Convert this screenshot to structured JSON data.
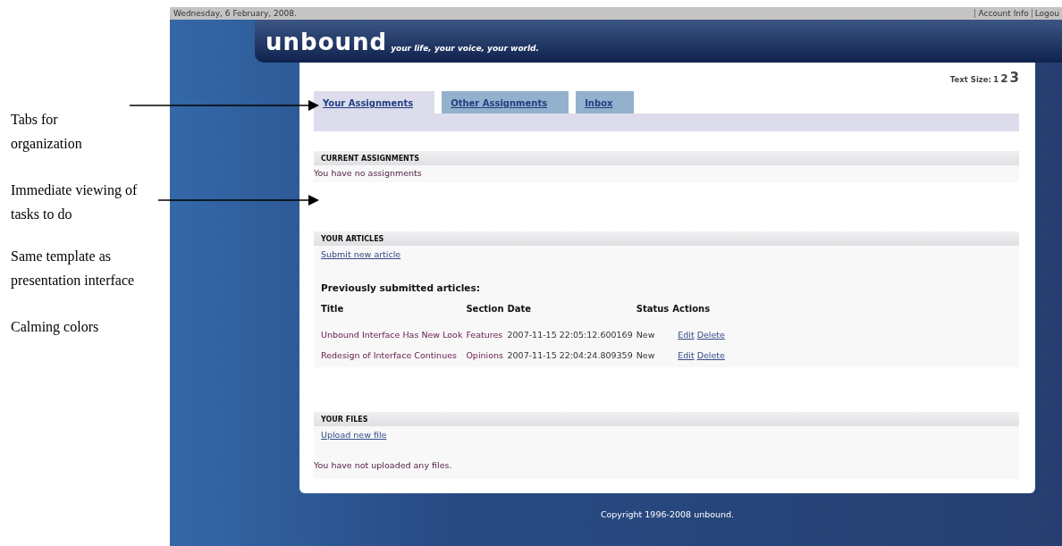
{
  "annotations": [
    {
      "text": "Tabs for organization",
      "arrow": true
    },
    {
      "text": "Immediate viewing of tasks to do",
      "arrow": true
    },
    {
      "text": "Same template as presentation interface",
      "arrow": false
    },
    {
      "text": "Calming colors",
      "arrow": false
    }
  ],
  "top_bar": {
    "date": "Wednesday, 6 February, 2008.",
    "links": [
      "Account Info",
      "Logou"
    ]
  },
  "header": {
    "logo": "unbound",
    "tagline": "your life, your voice, your world."
  },
  "text_size": {
    "label": "Text Size:",
    "options": [
      "1",
      "2",
      "3"
    ]
  },
  "tabs": [
    {
      "label": "Your Assignments",
      "selected": true
    },
    {
      "label": "Other Assignments",
      "selected": false
    },
    {
      "label": "Inbox",
      "selected": false
    }
  ],
  "sections": [
    {
      "kind": "message",
      "title": "CURRENT ASSIGNMENTS",
      "text": "You have no assignments"
    },
    {
      "kind": "articles",
      "title": "YOUR ARTICLES",
      "link": "Submit new article",
      "subtitle": "Previously submitted articles:",
      "columns": [
        "Title",
        "Section",
        "Date",
        "Status",
        "Actions"
      ],
      "rows": [
        {
          "title": "Unbound Interface Has New Look",
          "section": "Features",
          "date": "2007-11-15 22:05:12.600169",
          "status": "New",
          "actions": [
            "Edit",
            "Delete"
          ]
        },
        {
          "title": "Redesign of Interface Continues",
          "section": "Opinions",
          "date": "2007-11-15 22:04:24.809359",
          "status": "New",
          "actions": [
            "Edit",
            "Delete"
          ]
        }
      ]
    },
    {
      "kind": "files",
      "title": "YOUR FILES",
      "link": "Upload new file",
      "text": "You have not uploaded any files."
    }
  ],
  "footer": "Copyright 1996-2008 unbound."
}
